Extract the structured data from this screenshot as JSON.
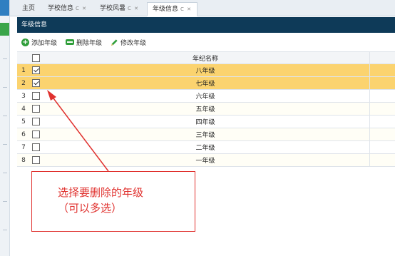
{
  "tabs": [
    {
      "label": "主页",
      "controls": ""
    },
    {
      "label": "学校信息",
      "controls": "C ✕"
    },
    {
      "label": "学校风暑",
      "controls": "C ✕"
    },
    {
      "label": "年级信息",
      "controls": "C ✕"
    }
  ],
  "panel": {
    "title": "年级信息"
  },
  "toolbar": {
    "add_label": "添加年级",
    "delete_label": "删除年级",
    "edit_label": "修改年级"
  },
  "grid": {
    "header": "年纪名称",
    "rows": [
      {
        "num": "1",
        "name": "八年级",
        "checked": true
      },
      {
        "num": "2",
        "name": "七年级",
        "checked": true
      },
      {
        "num": "3",
        "name": "六年级",
        "checked": false
      },
      {
        "num": "4",
        "name": "五年级",
        "checked": false
      },
      {
        "num": "5",
        "name": "四年级",
        "checked": false
      },
      {
        "num": "6",
        "name": "三年级",
        "checked": false
      },
      {
        "num": "7",
        "name": "二年级",
        "checked": false
      },
      {
        "num": "8",
        "name": "一年级",
        "checked": false
      }
    ]
  },
  "annotation": {
    "line1": "选择要删除的年级",
    "line2": "（可以多选）"
  },
  "colors": {
    "header_bar": "#0e3a58",
    "selected_row": "#fbd36f",
    "annotation": "#e0312e",
    "icon_green": "#2f9e3a"
  },
  "icons": {
    "add": "plus-circle-icon",
    "delete": "minus-rect-icon",
    "edit": "pencil-icon"
  }
}
